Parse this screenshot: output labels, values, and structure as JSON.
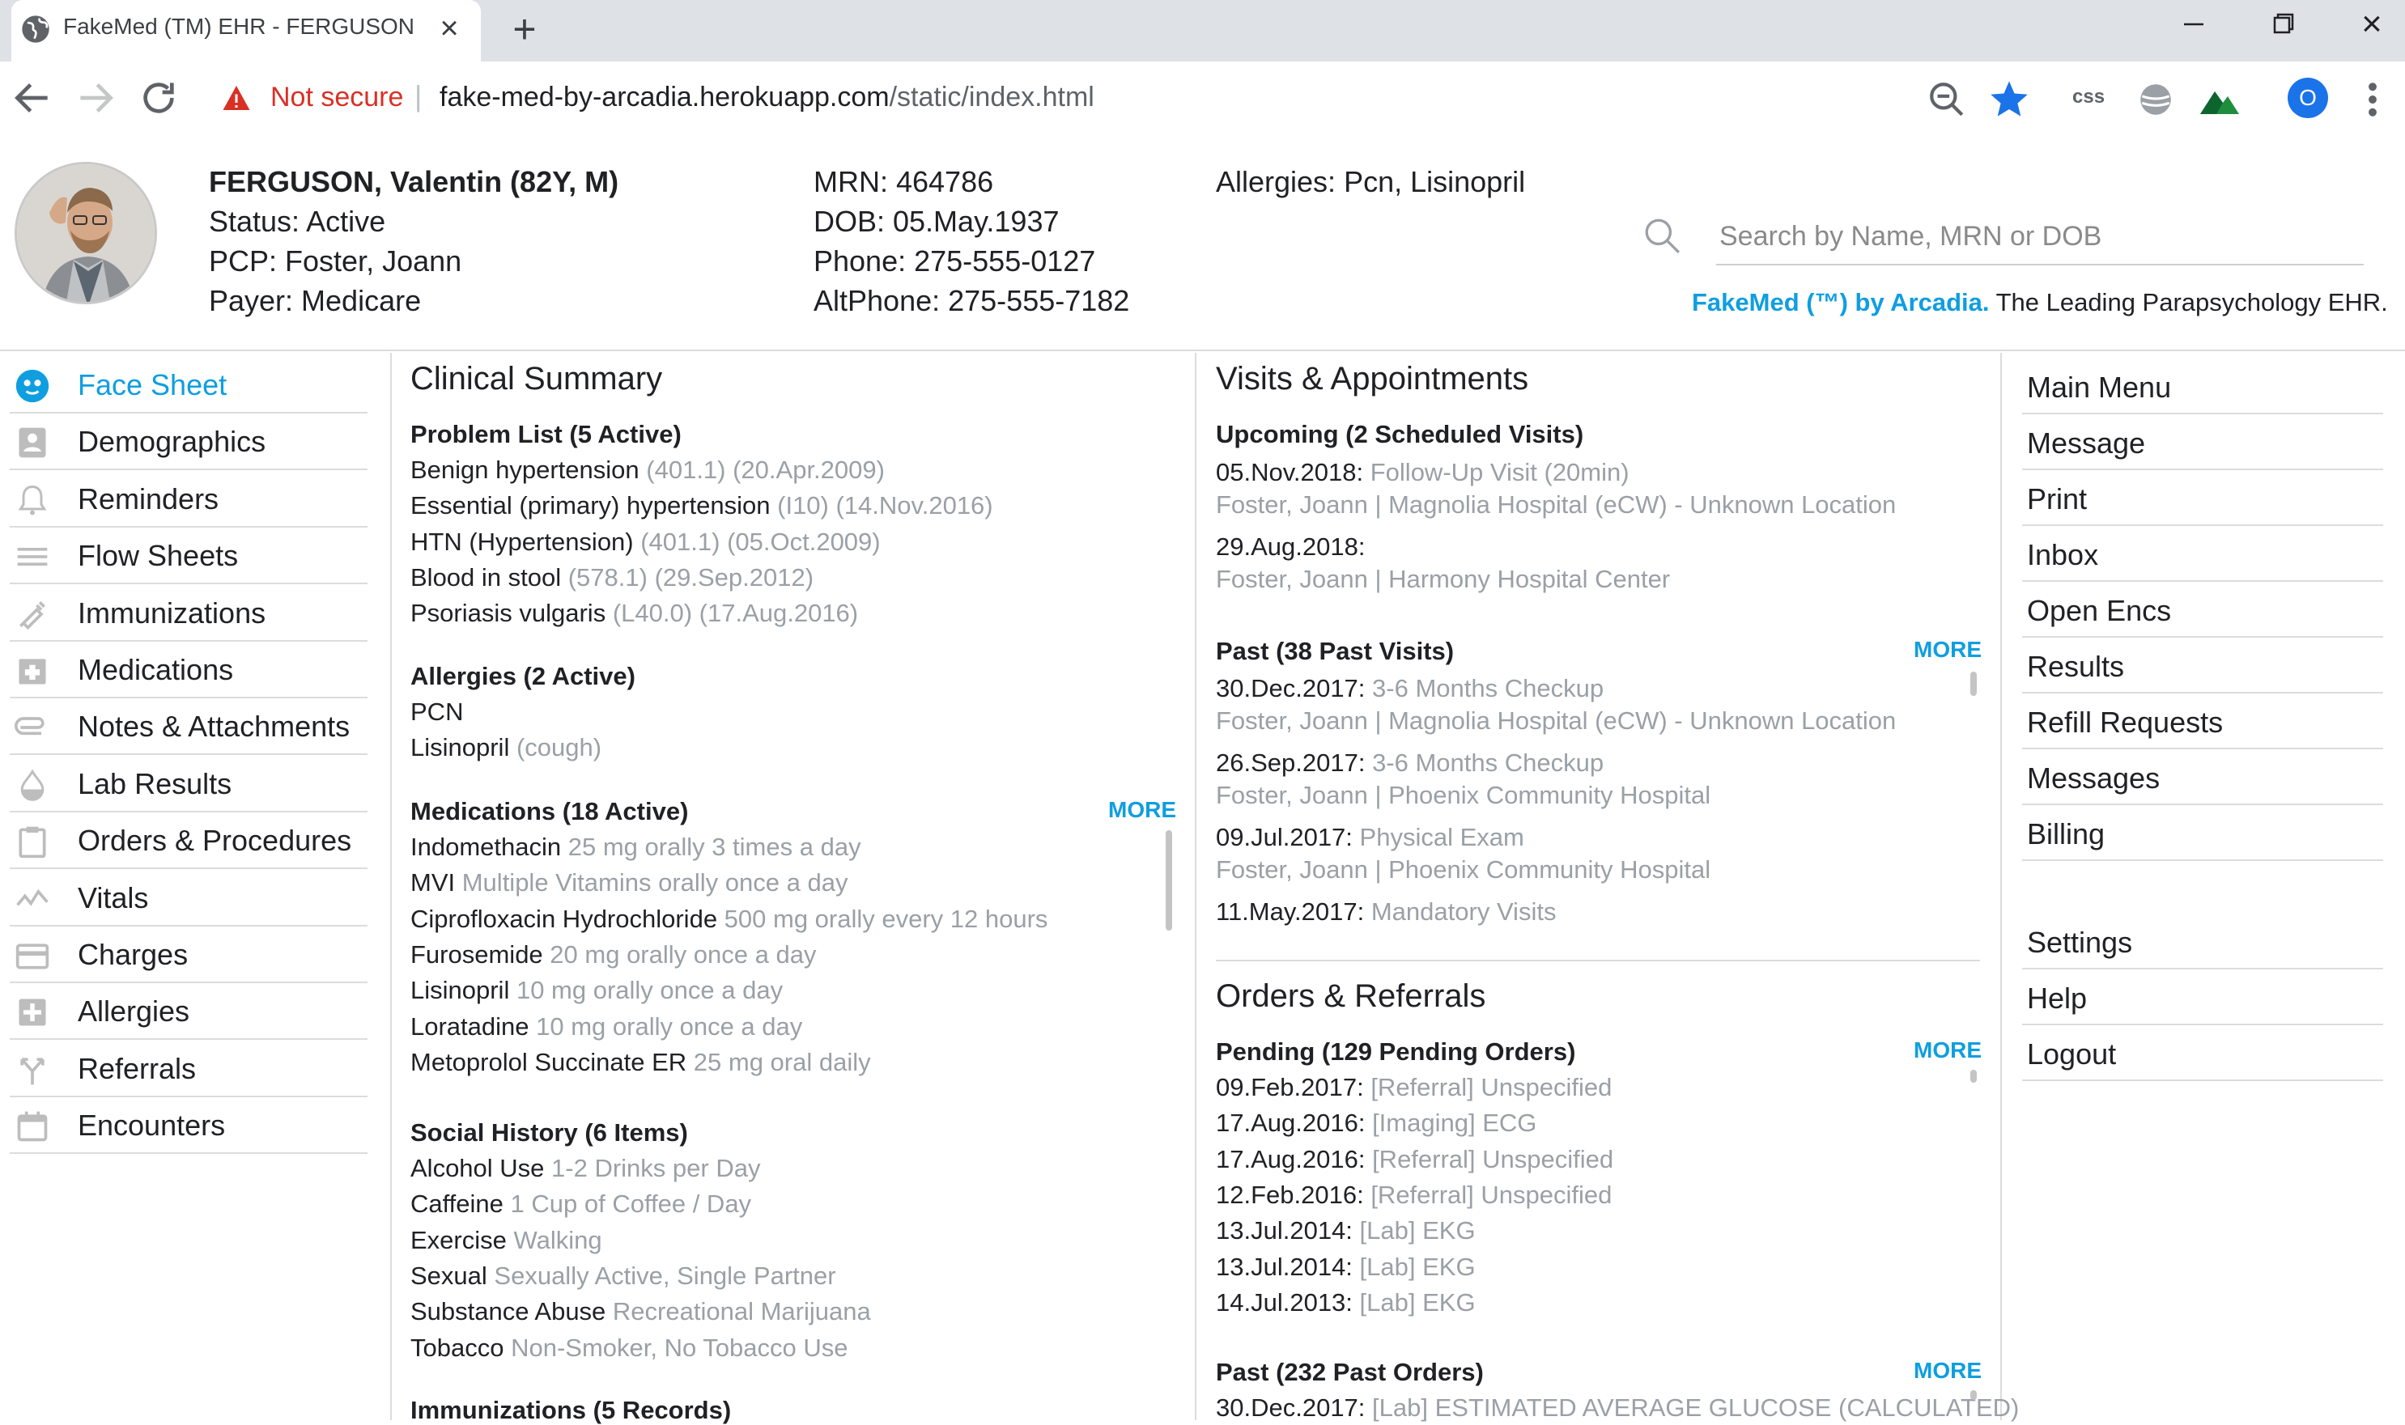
{
  "browser": {
    "tab_title": "FakeMed (TM) EHR - FERGUSON",
    "security_label": "Not secure",
    "url_host": "fake-med-by-arcadia.herokuapp.com",
    "url_path": "/static/index.html",
    "css_extension_label": "css",
    "profile_initial": "O"
  },
  "patient": {
    "name": "FERGUSON, Valentin (82Y, M)",
    "status": "Status: Active",
    "pcp": "PCP: Foster, Joann",
    "payer": "Payer: Medicare",
    "mrn": "MRN: 464786",
    "dob": "DOB: 05.May.1937",
    "phone": "Phone: 275-555-0127",
    "altphone": "AltPhone: 275-555-7182",
    "allergies": "Allergies: Pcn, Lisinopril"
  },
  "search": {
    "placeholder": "Search by Name, MRN or DOB"
  },
  "tagline": {
    "brand": "FakeMed (™) by Arcadia.",
    "text": " The Leading Parapsychology EHR."
  },
  "sidebar": {
    "items": [
      {
        "label": "Face Sheet",
        "icon": "face-icon",
        "active": true
      },
      {
        "label": "Demographics",
        "icon": "id-card-icon"
      },
      {
        "label": "Reminders",
        "icon": "bell-icon"
      },
      {
        "label": "Flow Sheets",
        "icon": "lines-icon"
      },
      {
        "label": "Immunizations",
        "icon": "syringe-icon"
      },
      {
        "label": "Medications",
        "icon": "pill-box-icon"
      },
      {
        "label": "Notes & Attachments",
        "icon": "paperclip-icon"
      },
      {
        "label": "Lab Results",
        "icon": "drop-icon"
      },
      {
        "label": "Orders & Procedures",
        "icon": "clipboard-icon"
      },
      {
        "label": "Vitals",
        "icon": "pulse-icon"
      },
      {
        "label": "Charges",
        "icon": "card-icon"
      },
      {
        "label": "Allergies",
        "icon": "plus-box-icon"
      },
      {
        "label": "Referrals",
        "icon": "fork-icon"
      },
      {
        "label": "Encounters",
        "icon": "calendar-icon"
      }
    ]
  },
  "right_menu": {
    "items": [
      "Main Menu",
      "Message",
      "Print",
      "Inbox",
      "Open Encs",
      "Results",
      "Refill Requests",
      "Messages",
      "Billing"
    ],
    "bottom_items": [
      "Settings",
      "Help",
      "Logout"
    ]
  },
  "clinical": {
    "title": "Clinical Summary",
    "problems": {
      "title": "Problem List (5 Active)",
      "items": [
        {
          "name": "Benign hypertension",
          "detail": " (401.1) (20.Apr.2009)"
        },
        {
          "name": "Essential (primary) hypertension",
          "detail": " (I10) (14.Nov.2016)"
        },
        {
          "name": "HTN (Hypertension)",
          "detail": " (401.1) (05.Oct.2009)"
        },
        {
          "name": "Blood in stool",
          "detail": " (578.1) (29.Sep.2012)"
        },
        {
          "name": "Psoriasis vulgaris",
          "detail": " (L40.0) (17.Aug.2016)"
        }
      ]
    },
    "allergies": {
      "title": "Allergies (2 Active)",
      "items": [
        {
          "name": "PCN",
          "detail": ""
        },
        {
          "name": "Lisinopril",
          "detail": " (cough)"
        }
      ]
    },
    "medications": {
      "title": "Medications (18 Active)",
      "more": "MORE",
      "items": [
        {
          "name": "Indomethacin",
          "detail": " 25 mg orally 3 times a day"
        },
        {
          "name": "MVI",
          "detail": " Multiple Vitamins orally once a day"
        },
        {
          "name": "Ciprofloxacin Hydrochloride",
          "detail": " 500 mg orally every 12 hours"
        },
        {
          "name": "Furosemide",
          "detail": " 20 mg orally once a day"
        },
        {
          "name": "Lisinopril",
          "detail": " 10 mg orally once a day"
        },
        {
          "name": "Loratadine",
          "detail": " 10 mg orally once a day"
        },
        {
          "name": "Metoprolol Succinate ER",
          "detail": " 25 mg oral daily"
        }
      ]
    },
    "social": {
      "title": "Social History (6 Items)",
      "items": [
        {
          "name": "Alcohol Use",
          "detail": " 1-2 Drinks per Day"
        },
        {
          "name": "Caffeine",
          "detail": " 1 Cup of Coffee / Day"
        },
        {
          "name": "Exercise",
          "detail": " Walking"
        },
        {
          "name": "Sexual",
          "detail": " Sexually Active, Single Partner"
        },
        {
          "name": "Substance Abuse",
          "detail": " Recreational Marijuana"
        },
        {
          "name": "Tobacco",
          "detail": " Non-Smoker, No Tobacco Use"
        }
      ]
    },
    "immunizations": {
      "title": "Immunizations (5 Records)"
    }
  },
  "visits": {
    "title": "Visits & Appointments",
    "upcoming": {
      "title": "Upcoming (2 Scheduled Visits)",
      "items": [
        {
          "date": "05.Nov.2018:",
          "desc": " Follow-Up Visit (20min)",
          "sub": "Foster, Joann | Magnolia Hospital (eCW) - Unknown Location"
        },
        {
          "date": "29.Aug.2018:",
          "desc": "",
          "sub": "Foster, Joann | Harmony Hospital Center"
        }
      ]
    },
    "past": {
      "title": "Past (38 Past Visits)",
      "more": "MORE",
      "items": [
        {
          "date": "30.Dec.2017:",
          "desc": " 3-6 Months Checkup",
          "sub": "Foster, Joann | Magnolia Hospital (eCW) - Unknown Location"
        },
        {
          "date": "26.Sep.2017:",
          "desc": " 3-6 Months Checkup",
          "sub": "Foster, Joann | Phoenix Community Hospital"
        },
        {
          "date": "09.Jul.2017:",
          "desc": " Physical Exam",
          "sub": "Foster, Joann | Phoenix Community Hospital"
        },
        {
          "date": "11.May.2017:",
          "desc": " Mandatory Visits",
          "sub": ""
        }
      ]
    }
  },
  "orders": {
    "title": "Orders & Referrals",
    "pending": {
      "title": "Pending (129 Pending Orders)",
      "more": "MORE",
      "items": [
        {
          "date": "09.Feb.2017:",
          "desc": " [Referral] Unspecified"
        },
        {
          "date": "17.Aug.2016:",
          "desc": " [Imaging] ECG"
        },
        {
          "date": "17.Aug.2016:",
          "desc": " [Referral] Unspecified"
        },
        {
          "date": "12.Feb.2016:",
          "desc": " [Referral] Unspecified"
        },
        {
          "date": "13.Jul.2014:",
          "desc": " [Lab] EKG"
        },
        {
          "date": "13.Jul.2014:",
          "desc": " [Lab] EKG"
        },
        {
          "date": "14.Jul.2013:",
          "desc": " [Lab] EKG"
        }
      ]
    },
    "past": {
      "title": "Past (232 Past Orders)",
      "more": "MORE",
      "items": [
        {
          "date": "30.Dec.2017:",
          "desc": " [Lab] ESTIMATED AVERAGE GLUCOSE (CALCULATED)"
        }
      ]
    }
  },
  "colors": {
    "accent": "#0f9ee0",
    "warning": "#d93025",
    "dim_text": "#9aa0a6",
    "divider": "#dcdcdc"
  }
}
